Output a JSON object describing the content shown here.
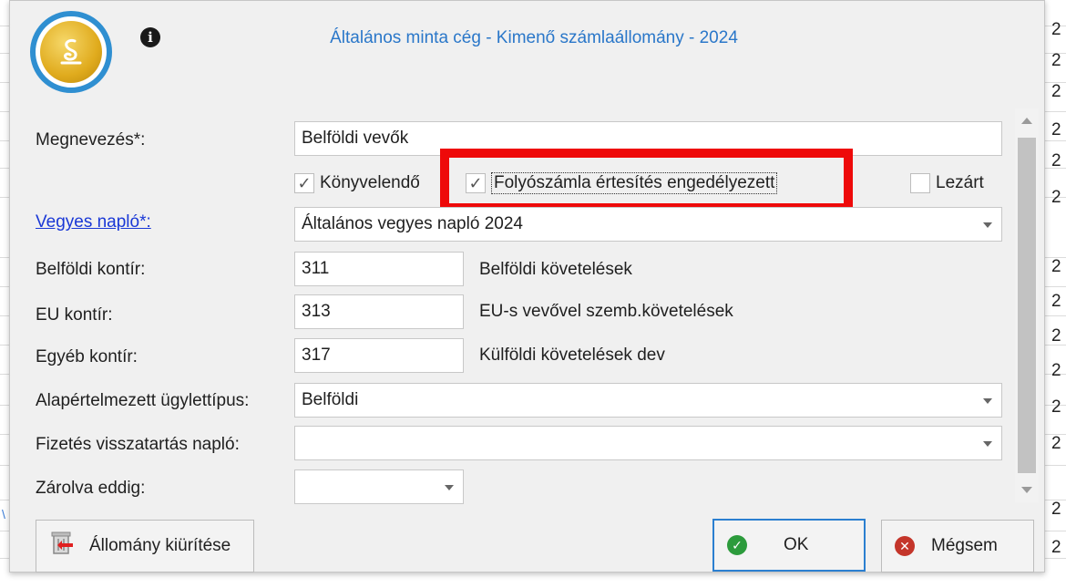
{
  "dialog": {
    "title": "Általános minta cég - Kimenő számlaállomány - 2024",
    "info_icon": "info-icon",
    "logo_icon": "app-logo-icon"
  },
  "form": {
    "name_label": "Megnevezés*:",
    "name_value": "Belföldi vevők",
    "checkboxes": {
      "konyvelendo": {
        "label": "Könyvelendő",
        "checked": true
      },
      "folyoszamla": {
        "label": "Folyószámla értesítés engedélyezett",
        "checked": true
      },
      "lezart": {
        "label": "Lezárt",
        "checked": false
      }
    },
    "journal_label": "Vegyes napló*:",
    "journal_value": "Általános vegyes napló 2024",
    "domestic_label": "Belföldi kontír:",
    "domestic_value": "311",
    "domestic_desc": "Belföldi követelések",
    "eu_label": "EU kontír:",
    "eu_value": "313",
    "eu_desc": "EU-s vevővel szemb.követelések",
    "other_label": "Egyéb kontír:",
    "other_value": "317",
    "other_desc": "Külföldi követelések dev",
    "deal_type_label": "Alapértelmezett ügylettípus:",
    "deal_type_value": "Belföldi",
    "retention_label": "Fizetés visszatartás napló:",
    "retention_value": "",
    "locked_until_label": "Zárolva eddig:",
    "locked_until_value": ""
  },
  "buttons": {
    "clear_label": "Állomány kiürítése",
    "ok_label": "OK",
    "cancel_label": "Mégsem"
  },
  "background": {
    "right_digit": "2",
    "left_mark": "\\"
  },
  "colors": {
    "highlight": "#ee0a0a",
    "title": "#2a77c9",
    "link": "#1a38d6",
    "ok_border": "#2b7fd0"
  }
}
